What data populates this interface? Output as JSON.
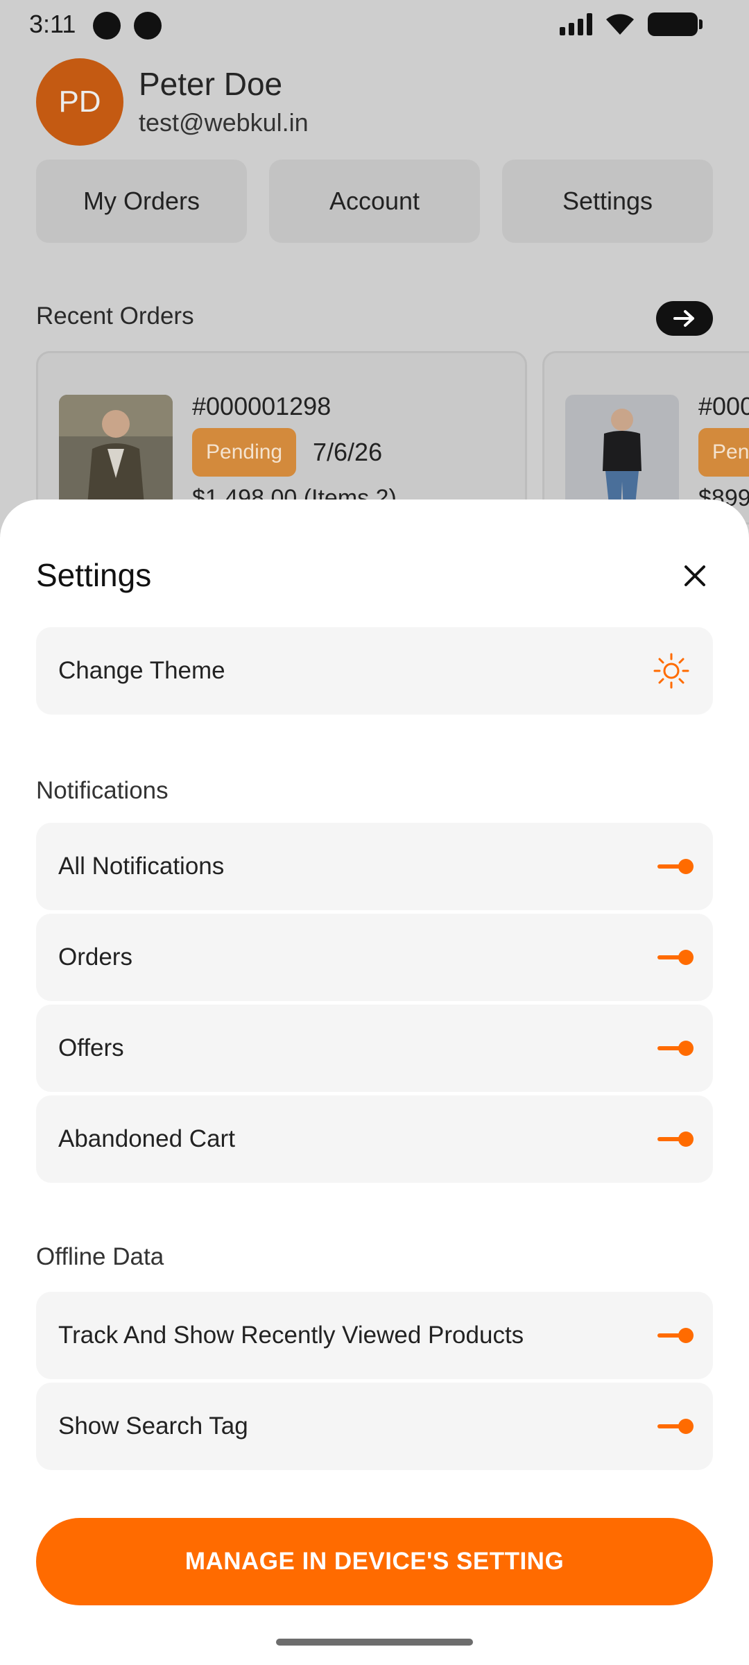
{
  "status": {
    "time": "3:11"
  },
  "profile": {
    "initials": "PD",
    "name": "Peter Doe",
    "email": "test@webkul.in"
  },
  "quick_actions": [
    {
      "label": "My Orders"
    },
    {
      "label": "Account"
    },
    {
      "label": "Settings"
    }
  ],
  "recent_orders": {
    "title": "Recent Orders",
    "orders": [
      {
        "number": "#000001298",
        "status": "Pending",
        "date": "7/6/26",
        "total": "$1,498.00 (Items 2)"
      },
      {
        "number": "#000",
        "status": "Pen",
        "date": "",
        "total": "$899"
      }
    ]
  },
  "settings_sheet": {
    "title": "Settings",
    "theme_row": {
      "label": "Change Theme",
      "icon": "sun-icon"
    },
    "notifications": {
      "section_label": "Notifications",
      "items": [
        {
          "label": "All Notifications",
          "enabled": true
        },
        {
          "label": "Orders",
          "enabled": true
        },
        {
          "label": "Offers",
          "enabled": true
        },
        {
          "label": "Abandoned Cart",
          "enabled": true
        }
      ]
    },
    "offline_data": {
      "section_label": "Offline Data",
      "items": [
        {
          "label": "Track And Show Recently Viewed Products",
          "enabled": true
        },
        {
          "label": "Show Search Tag",
          "enabled": true
        }
      ]
    },
    "cta_label": "MANAGE IN DEVICE'S SETTING"
  },
  "colors": {
    "accent": "#ff6b00",
    "badge": "#d38a3c",
    "avatar": "#c45a12"
  }
}
